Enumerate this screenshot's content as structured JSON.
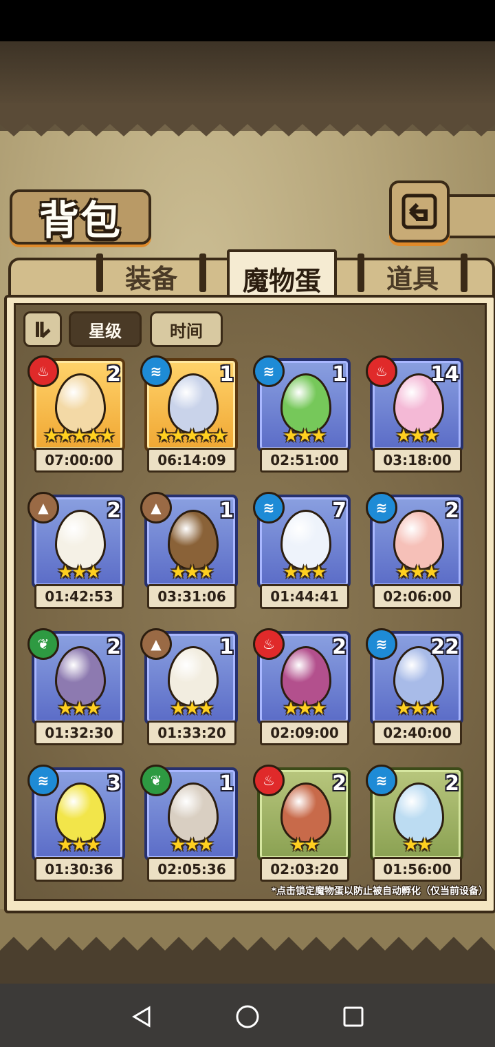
{
  "title": "背包",
  "tabs": [
    {
      "label": "装备",
      "active": false
    },
    {
      "label": "魔物蛋",
      "active": true
    },
    {
      "label": "道具",
      "active": false
    }
  ],
  "controls": {
    "sort_order_icon": "sort-order-icon",
    "star_label": "星级",
    "time_label": "时间"
  },
  "colors": {
    "fire": "#e02a2a",
    "water": "#1e8bd6",
    "earth": "#9a6a45",
    "grass": "#2e9a42",
    "frame_gold": "#f0a733",
    "frame_blue": "#5b6cc7",
    "frame_green": "#8aa152"
  },
  "eggs": [
    {
      "element": "fire",
      "frame": "gold",
      "count": "2",
      "stars": 5,
      "time": "07:00:00"
    },
    {
      "element": "water",
      "frame": "gold",
      "count": "1",
      "stars": 5,
      "time": "06:14:09"
    },
    {
      "element": "water",
      "frame": "blue",
      "count": "1",
      "stars": 3,
      "time": "02:51:00"
    },
    {
      "element": "fire",
      "frame": "blue",
      "count": "14",
      "stars": 3,
      "time": "03:18:00"
    },
    {
      "element": "earth",
      "frame": "blue",
      "count": "2",
      "stars": 3,
      "time": "01:42:53"
    },
    {
      "element": "earth",
      "frame": "blue",
      "count": "1",
      "stars": 3,
      "time": "03:31:06"
    },
    {
      "element": "water",
      "frame": "blue",
      "count": "7",
      "stars": 3,
      "time": "01:44:41"
    },
    {
      "element": "water",
      "frame": "blue",
      "count": "2",
      "stars": 3,
      "time": "02:06:00"
    },
    {
      "element": "grass",
      "frame": "blue",
      "count": "2",
      "stars": 3,
      "time": "01:32:30"
    },
    {
      "element": "earth",
      "frame": "blue",
      "count": "1",
      "stars": 3,
      "time": "01:33:20"
    },
    {
      "element": "fire",
      "frame": "blue",
      "count": "2",
      "stars": 3,
      "time": "02:09:00"
    },
    {
      "element": "water",
      "frame": "blue",
      "count": "22",
      "stars": 3,
      "time": "02:40:00"
    },
    {
      "element": "water",
      "frame": "blue",
      "count": "3",
      "stars": 3,
      "time": "01:30:36"
    },
    {
      "element": "grass",
      "frame": "blue",
      "count": "1",
      "stars": 3,
      "time": "02:05:36"
    },
    {
      "element": "fire",
      "frame": "green",
      "count": "2",
      "stars": 2,
      "time": "02:03:20"
    },
    {
      "element": "water",
      "frame": "green",
      "count": "2",
      "stars": 2,
      "time": "01:56:00"
    }
  ],
  "footnote": "*点击锁定魔物蛋以防止被自动孵化（仅当前设备）",
  "nav": {
    "back": "back-triangle-icon",
    "home": "home-circle-icon",
    "recents": "recents-square-icon"
  }
}
